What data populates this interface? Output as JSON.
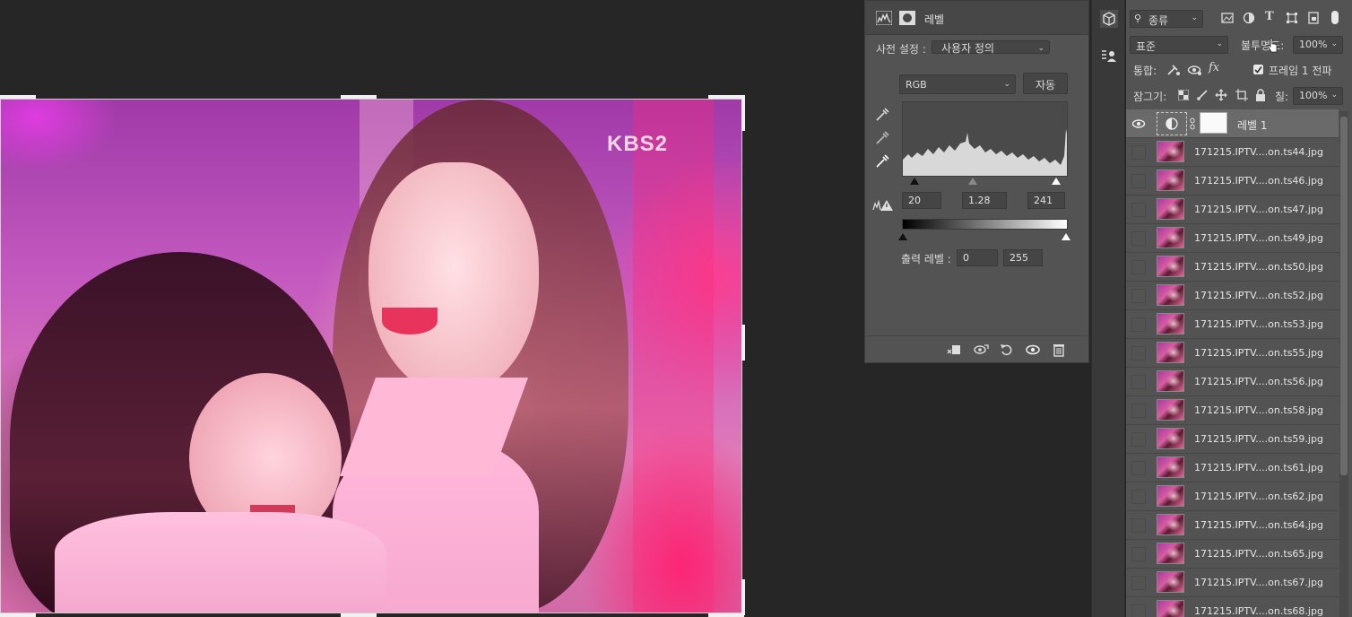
{
  "canvas": {
    "watermark": "KBS2"
  },
  "properties": {
    "panel_title": "레벨",
    "preset_label": "사전 설정 :",
    "preset_value": "사용자 정의",
    "channel_value": "RGB",
    "auto_button": "자동",
    "input_black": "20",
    "input_gamma": "1.28",
    "input_white": "241",
    "output_label": "출력 레벨 :",
    "output_black": "0",
    "output_white": "255"
  },
  "layers": {
    "filter_kind": "종류",
    "blend_mode": "표준",
    "opacity_label": "불투명도:",
    "opacity_value": "100%",
    "unify_label": "통합:",
    "frame_propagate_label": "프레임 1 전파",
    "lock_label": "잠그기:",
    "fill_label": "칠:",
    "fill_value": "100%",
    "adjustment_layer_name": "레벨 1",
    "items": [
      "171215.IPTV....on.ts44.jpg",
      "171215.IPTV....on.ts46.jpg",
      "171215.IPTV....on.ts47.jpg",
      "171215.IPTV....on.ts49.jpg",
      "171215.IPTV....on.ts50.jpg",
      "171215.IPTV....on.ts52.jpg",
      "171215.IPTV....on.ts53.jpg",
      "171215.IPTV....on.ts55.jpg",
      "171215.IPTV....on.ts56.jpg",
      "171215.IPTV....on.ts58.jpg",
      "171215.IPTV....on.ts59.jpg",
      "171215.IPTV....on.ts61.jpg",
      "171215.IPTV....on.ts62.jpg",
      "171215.IPTV....on.ts64.jpg",
      "171215.IPTV....on.ts65.jpg",
      "171215.IPTV....on.ts67.jpg",
      "171215.IPTV....on.ts68.jpg"
    ]
  },
  "colors": {
    "panel_bg": "#535353",
    "app_bg": "#262626",
    "accent_active_row": "#6a6a6a"
  }
}
